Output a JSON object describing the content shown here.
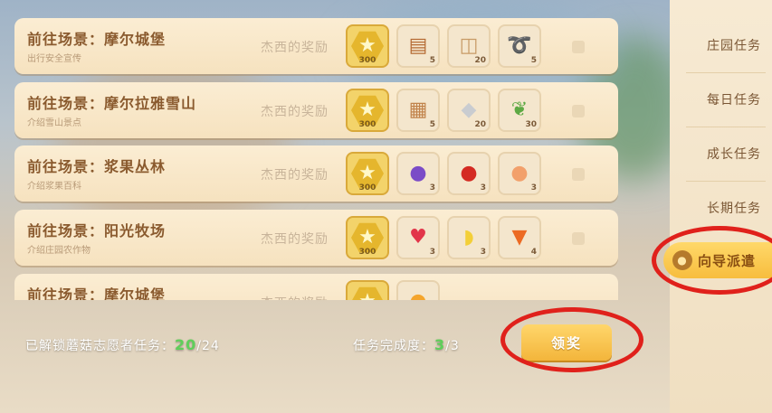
{
  "reward_label": "杰西的奖励",
  "tasks": [
    {
      "title": "前往场景：摩尔城堡",
      "desc": "出行安全宣传",
      "rewards": [
        {
          "icon": "star-coin",
          "qty": "300"
        },
        {
          "icon": "wood-planks",
          "qty": "5"
        },
        {
          "icon": "log",
          "qty": "20"
        },
        {
          "icon": "rope",
          "qty": "5"
        }
      ]
    },
    {
      "title": "前往场景：摩尔拉雅雪山",
      "desc": "介绍雪山景点",
      "rewards": [
        {
          "icon": "star-coin",
          "qty": "300"
        },
        {
          "icon": "wood-blocks",
          "qty": "5"
        },
        {
          "icon": "stone",
          "qty": "20"
        },
        {
          "icon": "grass-bundle",
          "qty": "30"
        }
      ]
    },
    {
      "title": "前往场景：浆果丛林",
      "desc": "介绍浆果百科",
      "rewards": [
        {
          "icon": "star-coin",
          "qty": "300"
        },
        {
          "icon": "grape",
          "qty": "3"
        },
        {
          "icon": "apple",
          "qty": "3"
        },
        {
          "icon": "peach",
          "qty": "3"
        }
      ]
    },
    {
      "title": "前往场景：阳光牧场",
      "desc": "介绍庄园农作物",
      "rewards": [
        {
          "icon": "star-coin",
          "qty": "300"
        },
        {
          "icon": "strawberry",
          "qty": "3"
        },
        {
          "icon": "banana",
          "qty": "3"
        },
        {
          "icon": "carrot",
          "qty": "4"
        }
      ]
    },
    {
      "title": "前往场景：摩尔城堡",
      "desc": "",
      "rewards": [
        {
          "icon": "star-coin",
          "qty": ""
        },
        {
          "icon": "orange-fruit",
          "qty": ""
        }
      ]
    }
  ],
  "footer": {
    "unlock_label": "已解锁蘑菇志愿者任务：",
    "unlock_done": "20",
    "unlock_total": "/24",
    "progress_label": "任务完成度：",
    "progress_done": "3",
    "progress_total": "/3",
    "claim_button": "领奖"
  },
  "sidebar": {
    "items": [
      "庄园任务",
      "每日任务",
      "成长任务",
      "长期任务"
    ],
    "guide_tab": "向导派遣"
  },
  "colors": {
    "highlight_ring": "#e0211b",
    "accent": "#f3b53b",
    "progress_green": "#5fcf5a"
  }
}
